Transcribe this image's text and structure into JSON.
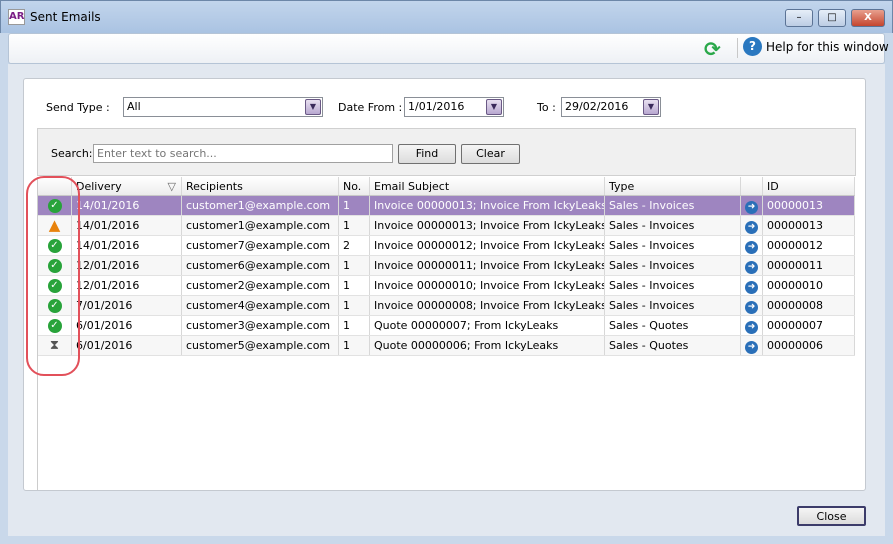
{
  "window": {
    "logo": "AR",
    "title": "Sent Emails",
    "min": "–",
    "max": "□",
    "close": "X"
  },
  "toolbar": {
    "refresh_icon": "refresh-icon",
    "help_label": "Help for this window"
  },
  "filters": {
    "send_type_label": "Send Type :",
    "send_type_value": "All",
    "date_from_label": "Date From :",
    "date_from_value": "1/01/2016",
    "to_label": "To :",
    "to_value": "29/02/2016"
  },
  "search": {
    "label": "Search:",
    "placeholder": "Enter text to search...",
    "find": "Find",
    "clear": "Clear"
  },
  "grid": {
    "columns": [
      "",
      "Delivery",
      "Recipients",
      "No.",
      "Email Subject",
      "Type",
      "",
      "ID"
    ],
    "rows": [
      {
        "status": "ok",
        "delivery": "14/01/2016",
        "recipient": "customer1@example.com",
        "no": "1",
        "subject": "Invoice 00000013; Invoice From IckyLeaks",
        "type": "Sales - Invoices",
        "id": "00000013"
      },
      {
        "status": "warning",
        "delivery": "14/01/2016",
        "recipient": "customer1@example.com",
        "no": "1",
        "subject": "Invoice 00000013; Invoice From IckyLeaks",
        "type": "Sales - Invoices",
        "id": "00000013"
      },
      {
        "status": "ok",
        "delivery": "14/01/2016",
        "recipient": "customer7@example.com",
        "no": "2",
        "subject": "Invoice 00000012; Invoice From IckyLeaks",
        "type": "Sales - Invoices",
        "id": "00000012"
      },
      {
        "status": "ok",
        "delivery": "12/01/2016",
        "recipient": "customer6@example.com",
        "no": "1",
        "subject": "Invoice 00000011; Invoice From IckyLeaks",
        "type": "Sales - Invoices",
        "id": "00000011"
      },
      {
        "status": "ok",
        "delivery": "12/01/2016",
        "recipient": "customer2@example.com",
        "no": "1",
        "subject": "Invoice 00000010; Invoice From IckyLeaks",
        "type": "Sales - Invoices",
        "id": "00000010"
      },
      {
        "status": "ok",
        "delivery": "7/01/2016",
        "recipient": "customer4@example.com",
        "no": "1",
        "subject": "Invoice 00000008; Invoice From IckyLeaks",
        "type": "Sales - Invoices",
        "id": "00000008"
      },
      {
        "status": "ok",
        "delivery": "6/01/2016",
        "recipient": "customer3@example.com",
        "no": "1",
        "subject": "Quote 00000007; From IckyLeaks",
        "type": "Sales - Quotes",
        "id": "00000007"
      },
      {
        "status": "pending",
        "delivery": "6/01/2016",
        "recipient": "customer5@example.com",
        "no": "1",
        "subject": "Quote 00000006; From IckyLeaks",
        "type": "Sales - Quotes",
        "id": "00000006"
      }
    ]
  },
  "footer": {
    "close": "Close"
  },
  "colors": {
    "selected": "#9e85c0",
    "ok": "#28a33a",
    "warning": "#e8820c",
    "annotation": "#e2505a"
  }
}
